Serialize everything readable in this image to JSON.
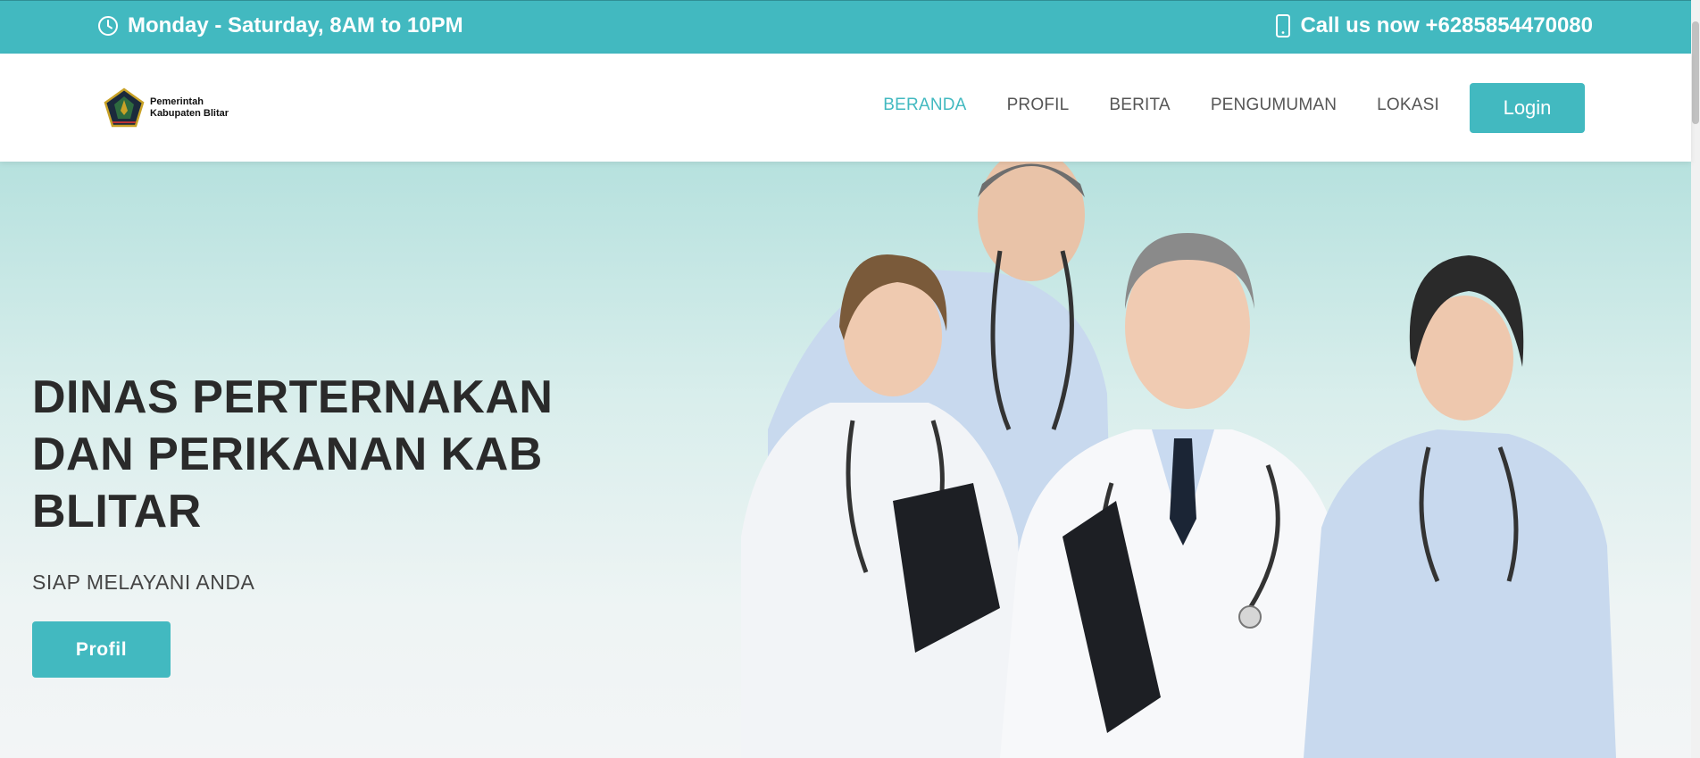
{
  "topbar": {
    "hours": "Monday - Saturday, 8AM to 10PM",
    "phone": "Call us now +6285854470080",
    "hours_icon": "clock-icon",
    "phone_icon": "phone-icon"
  },
  "header": {
    "logo_line1": "Pemerintah",
    "logo_line2": "Kabupaten Blitar",
    "nav": [
      "BERANDA",
      "PROFIL",
      "BERITA",
      "PENGUMUMAN",
      "LOKASI"
    ],
    "active_nav": "BERANDA",
    "login_label": "Login"
  },
  "hero": {
    "title": "DINAS PERTERNAKAN DAN PERIKANAN KAB BLITAR",
    "subtitle": "SIAP MELAYANI ANDA",
    "button_label": "Profil"
  },
  "colors": {
    "accent": "#42b9c0",
    "nav_text": "#555555",
    "title_text": "#2a2a2a"
  }
}
